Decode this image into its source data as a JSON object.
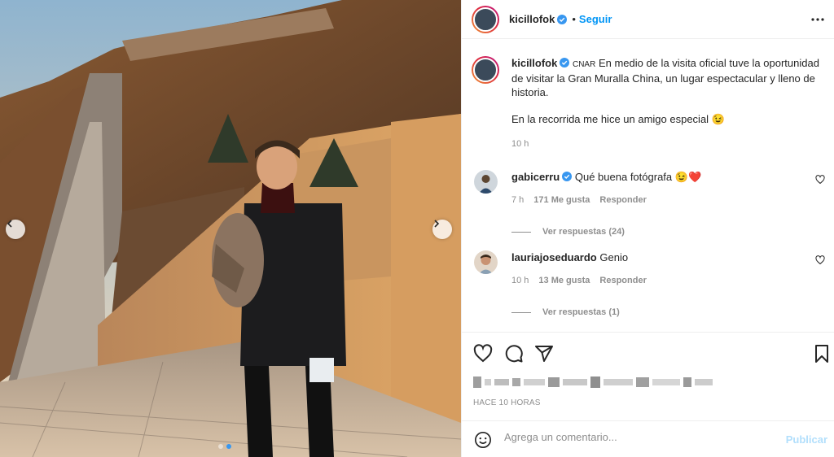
{
  "post": {
    "username": "kicillofok",
    "follow_label": "Seguir",
    "separator": "•",
    "icons": {
      "verified": "verified-badge-icon",
      "more": "more-options-icon",
      "prev": "chevron-left-icon",
      "next": "chevron-right-icon"
    }
  },
  "caption": {
    "username": "kicillofok",
    "badge": "CNAR",
    "text_1": "En medio de la visita oficial tuve la oportunidad de visitar la Gran Muralla China, un lugar espectacular y lleno de historia.",
    "text_2": "En la recorrida me hice un amigo especial",
    "emoji_2": "😉",
    "time": "10 h"
  },
  "comments": [
    {
      "username": "gabicerru",
      "text": "Qué buena fotógrafa",
      "emoji": "😉❤️",
      "time": "7 h",
      "likes": "171 Me gusta",
      "reply_label": "Responder",
      "view_replies": "Ver respuestas (24)"
    },
    {
      "username": "lauriajoseduardo",
      "text": "Genio",
      "time": "10 h",
      "likes": "13 Me gusta",
      "reply_label": "Responder",
      "view_replies": "Ver respuestas (1)"
    }
  ],
  "actions": {
    "like_icon": "heart-icon",
    "comment_icon": "comment-icon",
    "share_icon": "paper-plane-icon",
    "save_icon": "bookmark-icon"
  },
  "timestamp": "HACE 10 HORAS",
  "add_comment": {
    "placeholder": "Agrega un comentario...",
    "publish_label": "Publicar",
    "emoji_icon": "smiley-icon"
  },
  "carousel": {
    "count": 2,
    "active": 2
  },
  "colors": {
    "link_blue": "#0095f6",
    "publish_disabled": "#b2dffc",
    "verified_blue": "#3897f0",
    "heart_red": "#ed4956"
  }
}
